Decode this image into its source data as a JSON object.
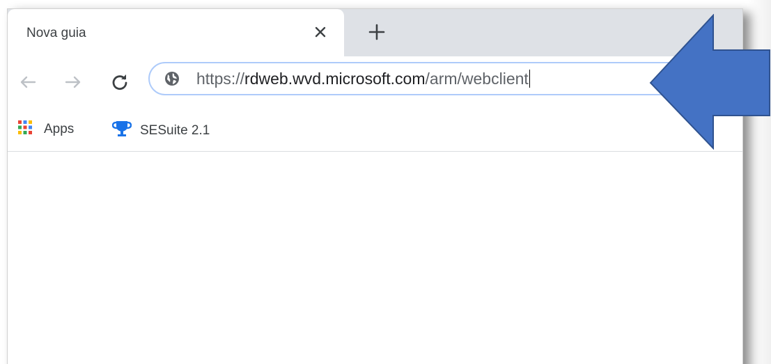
{
  "tab": {
    "title": "Nova guia",
    "close_icon": "close-icon",
    "new_tab_icon": "plus-icon"
  },
  "toolbar": {
    "back_icon": "arrow-left-icon",
    "forward_icon": "arrow-right-icon",
    "reload_icon": "reload-icon",
    "site_icon": "globe-icon"
  },
  "omnibox": {
    "scheme": "https://",
    "host": "rdweb.wvd.microsoft.com",
    "path": "/arm/webclient"
  },
  "bookmarks": {
    "items": [
      {
        "label": "Apps",
        "icon": "apps-grid-icon"
      },
      {
        "label": "SESuite 2.1",
        "icon": "trophy-icon"
      }
    ]
  },
  "annotation": {
    "icon": "blue-arrow-icon",
    "color": "#4472c4"
  },
  "colors": {
    "tabstrip": "#dee1e6",
    "omnibox_border": "#aecbfa",
    "trophy": "#1a73e8"
  }
}
